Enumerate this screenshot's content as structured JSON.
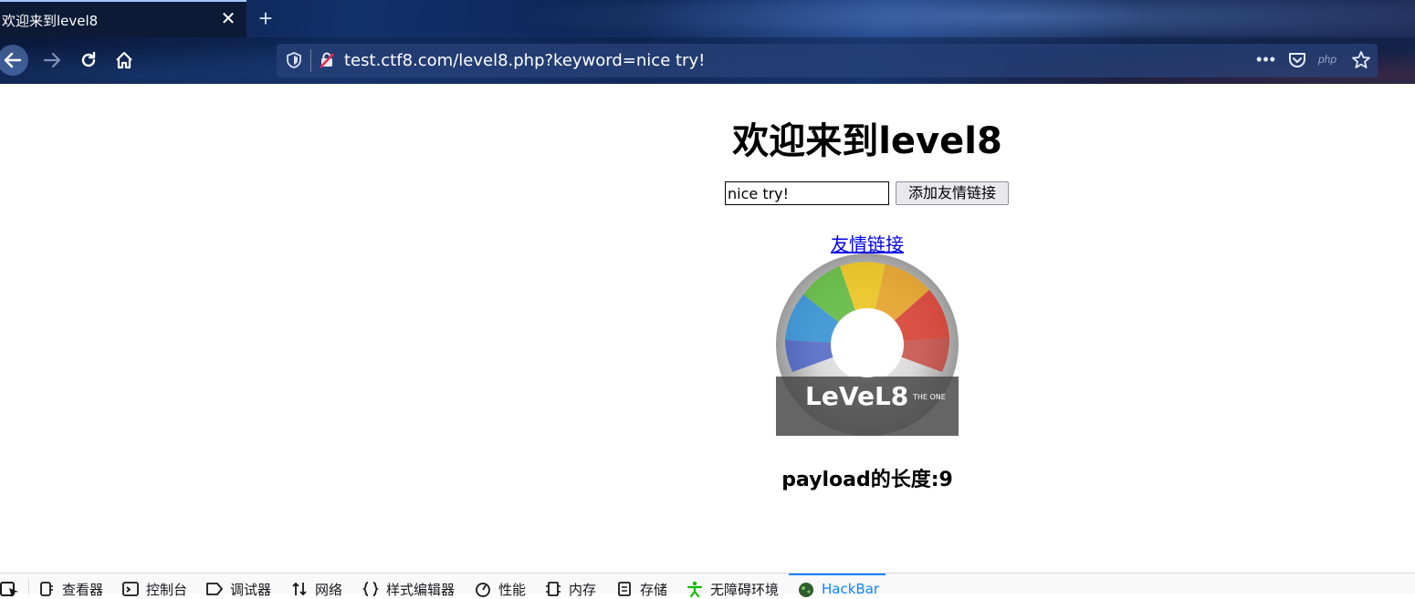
{
  "browser": {
    "tab": {
      "title": "欢迎来到level8",
      "close_icon": "close-icon"
    },
    "newtab_icon": "plus-icon",
    "nav": {
      "back_icon": "arrow-left-icon",
      "forward_icon": "arrow-right-icon",
      "reload_icon": "reload-icon",
      "home_icon": "home-icon"
    },
    "url": "test.ctf8.com/level8.php?keyword=nice try!",
    "url_icons": [
      "shield-icon",
      "insecure-lock-icon",
      "more-icon",
      "pocket-icon",
      "star-icon"
    ],
    "php_badge": "php"
  },
  "page": {
    "title": "欢迎来到level8",
    "keyword_input_value": "nice try!",
    "add_button_label": "添加友情链接",
    "friend_link_text": "友情链接",
    "disc_logo_text": "LeVeL8",
    "disc_subtext": "THE ONE",
    "payload_length": "payload的长度:9"
  },
  "devtools": {
    "items": [
      {
        "label": "查看器",
        "icon": "inspector-icon"
      },
      {
        "label": "控制台",
        "icon": "console-icon"
      },
      {
        "label": "调试器",
        "icon": "debugger-icon"
      },
      {
        "label": "网络",
        "icon": "network-icon"
      },
      {
        "label": "样式编辑器",
        "icon": "style-editor-icon"
      },
      {
        "label": "性能",
        "icon": "performance-icon"
      },
      {
        "label": "内存",
        "icon": "memory-icon"
      },
      {
        "label": "存储",
        "icon": "storage-icon"
      },
      {
        "label": "无障碍环境",
        "icon": "accessibility-icon"
      },
      {
        "label": "HackBar",
        "icon": "hackbar-icon",
        "active": true
      }
    ],
    "accent_color": "#0a84ff"
  }
}
